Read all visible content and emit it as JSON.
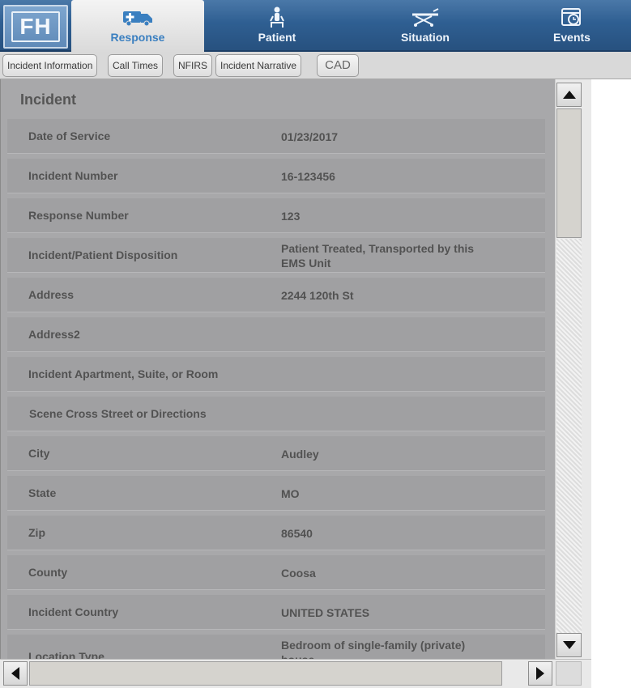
{
  "logo": {
    "text": "FH"
  },
  "tabs": [
    {
      "label": "Response",
      "icon": "ambulance-icon",
      "active": true
    },
    {
      "label": "Patient",
      "icon": "patient-icon",
      "active": false
    },
    {
      "label": "Situation",
      "icon": "stretcher-icon",
      "active": false
    },
    {
      "label": "Events",
      "icon": "calendar-clock-icon",
      "active": false
    }
  ],
  "subtabs": [
    "Incident Information",
    "Call Times",
    "NFIRS",
    "Incident Narrative",
    "CAD"
  ],
  "section": {
    "title": "Incident"
  },
  "fields": [
    {
      "label": "Date of Service",
      "value": "01/23/2017"
    },
    {
      "label": "Incident Number",
      "value": "16-123456"
    },
    {
      "label": "Response Number",
      "value": "123"
    },
    {
      "label": "Incident/Patient Disposition",
      "value": "Patient Treated, Transported by this EMS Unit"
    },
    {
      "label": "Address",
      "value": "2244 120th St"
    },
    {
      "label": "Address2",
      "value": ""
    },
    {
      "label": "Incident Apartment, Suite, or Room",
      "value": ""
    },
    {
      "label": "Scene Cross Street or Directions",
      "value": ""
    },
    {
      "label": "City",
      "value": "Audley"
    },
    {
      "label": "State",
      "value": "MO"
    },
    {
      "label": "Zip",
      "value": "86540"
    },
    {
      "label": "County",
      "value": "Coosa"
    },
    {
      "label": "Incident Country",
      "value": "UNITED STATES"
    },
    {
      "label": "Location Type",
      "value": "Bedroom of single-family (private) house"
    }
  ],
  "colors": {
    "accent": "#3a7fc0",
    "nav": "#2f5f92",
    "row": "#a0a0a2"
  }
}
